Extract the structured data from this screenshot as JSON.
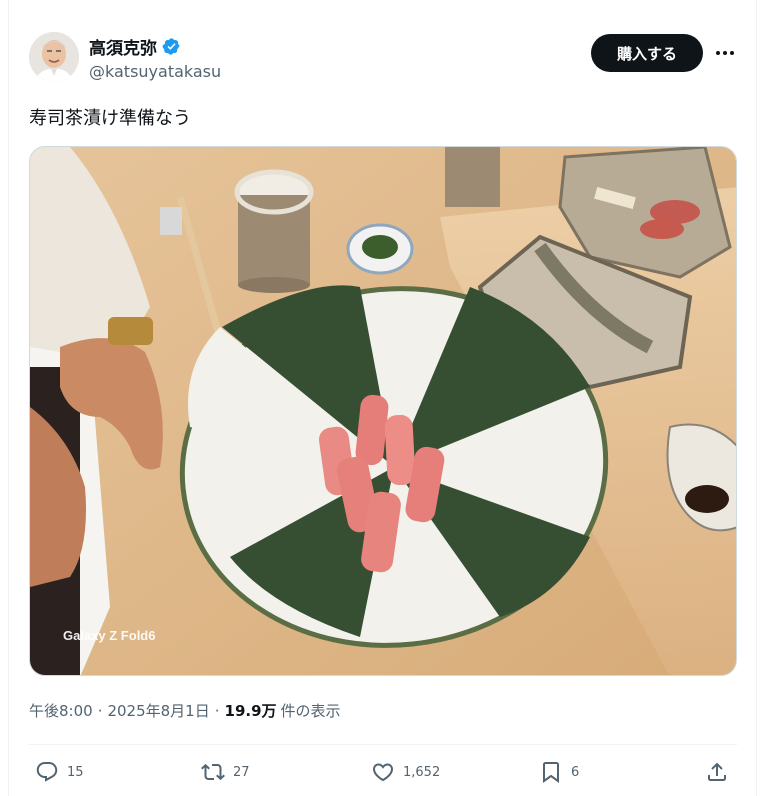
{
  "author": {
    "display_name": "高須克弥",
    "handle": "@katsuyatakasu",
    "verified": true,
    "avatar_icon": "avatar-photo"
  },
  "header": {
    "buy_label": "購入する",
    "more_icon": "more-horizontal-icon"
  },
  "tweet": {
    "text": "寿司茶漬け準備なう",
    "image_watermark": "Galaxy Z Fold6",
    "time": "午後8:00",
    "sep1": "·",
    "date": "2025年8月1日",
    "sep2": "·",
    "views_count": "19.9万",
    "views_label": "件の表示"
  },
  "actions": {
    "replies": "15",
    "retweets": "27",
    "likes": "1,652",
    "bookmarks": "6"
  },
  "colors": {
    "text_primary": "#0f1419",
    "text_secondary": "#536471",
    "verified_blue": "#1d9bf0",
    "button_dark": "#0f1419"
  }
}
